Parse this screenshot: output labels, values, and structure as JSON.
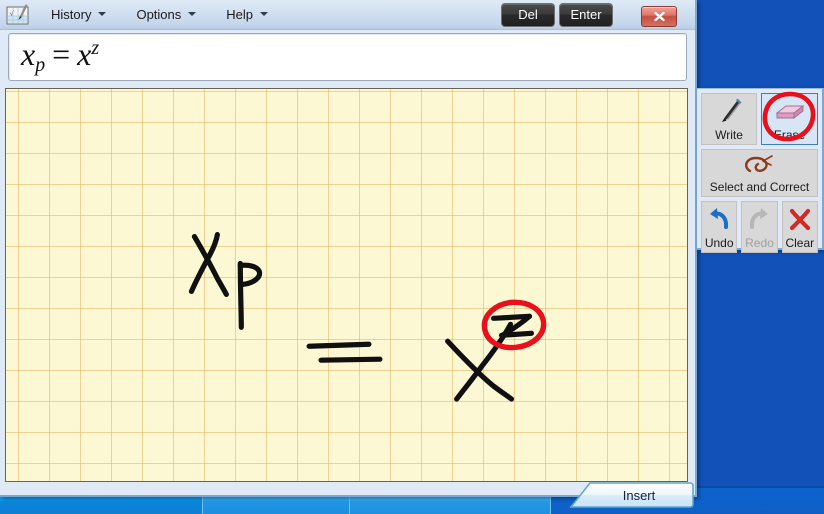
{
  "window": {
    "app_icon": "math-input-panel-icon",
    "close_label": "x"
  },
  "menu": {
    "items": [
      {
        "label": "History",
        "icon": "chevron-down-icon"
      },
      {
        "label": "Options",
        "icon": "chevron-down-icon"
      },
      {
        "label": "Help",
        "icon": "chevron-down-icon"
      }
    ]
  },
  "commands": {
    "del_label": "Del",
    "enter_label": "Enter"
  },
  "preview": {
    "base1": "x",
    "subscript": "p",
    "equals": "=",
    "base2": "x",
    "superscript": "z",
    "plain_text": "x_p = x^z"
  },
  "canvas": {
    "background_color": "#fdf8d4",
    "grid_line_color": "#e2b25c",
    "ink_color": "#101010",
    "marker_color": "#e8101a",
    "handwriting_text": "x_p = x^z",
    "annotation_note": "red circle around handwritten z"
  },
  "toolbar": {
    "write": {
      "label": "Write",
      "icon": "pen-icon",
      "selected": false,
      "enabled": true
    },
    "erase": {
      "label": "Erase",
      "icon": "eraser-icon",
      "selected": true,
      "enabled": true
    },
    "select": {
      "label": "Select and Correct",
      "icon": "lasso-icon",
      "selected": false,
      "enabled": true
    },
    "undo": {
      "label": "Undo",
      "icon": "undo-arrow-icon",
      "selected": false,
      "enabled": true
    },
    "redo": {
      "label": "Redo",
      "icon": "redo-arrow-icon",
      "selected": false,
      "enabled": false
    },
    "clear": {
      "label": "Clear",
      "icon": "red-x-icon",
      "selected": false,
      "enabled": true
    }
  },
  "footer": {
    "insert_label": "Insert"
  },
  "colors": {
    "accent_blue": "#1151b8",
    "selected_border": "#3a7ebf",
    "marker_red": "#e8101a",
    "close_red": "#c44f42"
  }
}
